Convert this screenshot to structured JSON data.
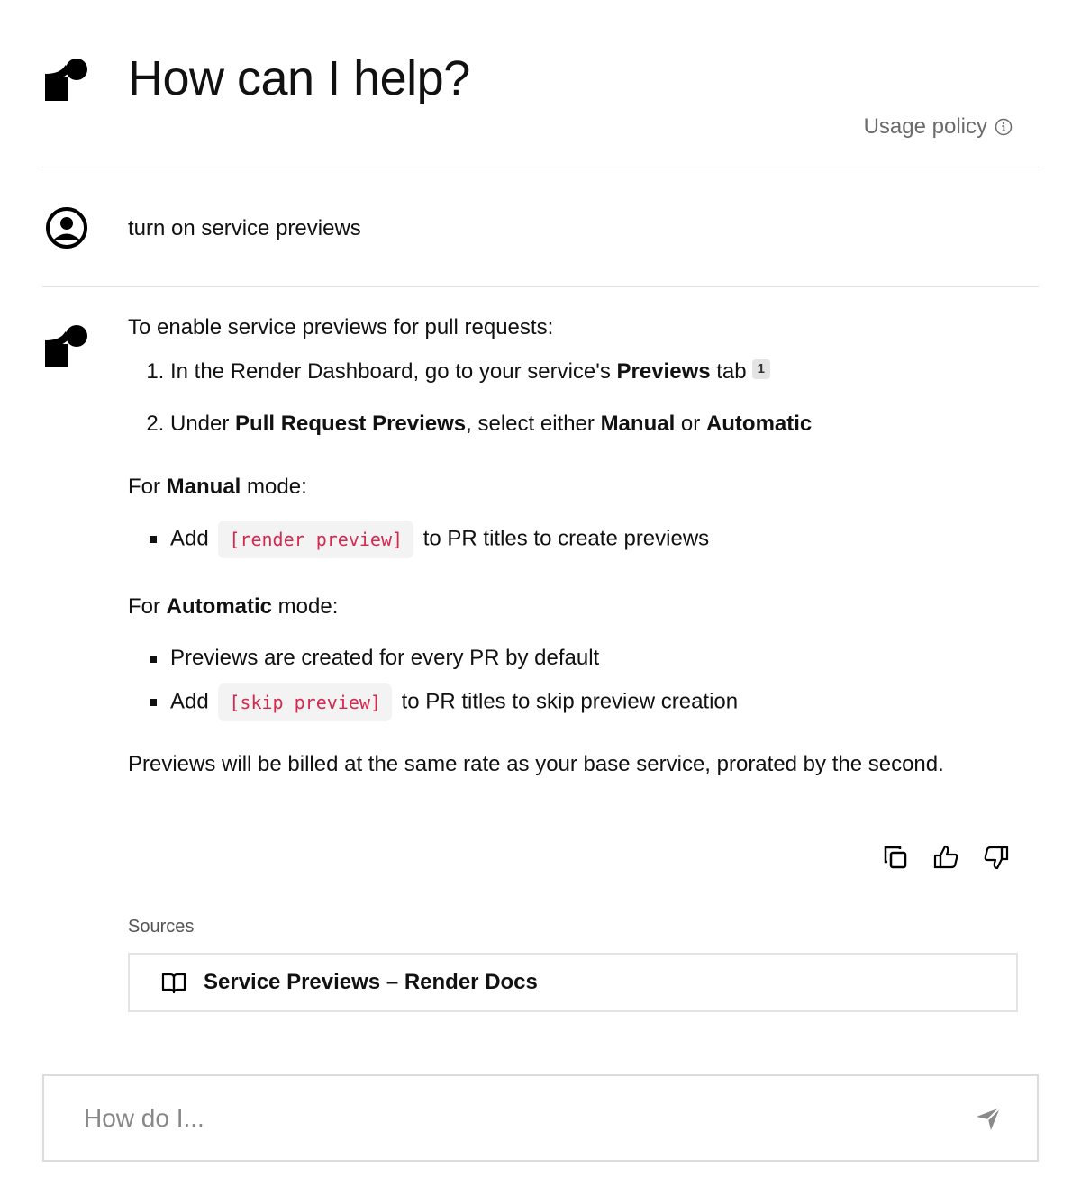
{
  "header": {
    "title": "How can I help?",
    "usage_policy": "Usage policy"
  },
  "user_message": "turn on service previews",
  "answer": {
    "intro": "To enable service previews for pull requests:",
    "steps": [
      {
        "prefix": "In the Render Dashboard, go to your service's ",
        "bold": "Previews",
        "suffix": " tab",
        "citation": "1"
      },
      {
        "prefix": "Under ",
        "bold1": "Pull Request Previews",
        "mid": ", select either ",
        "bold2": "Manual",
        "or": " or ",
        "bold3": "Automatic"
      }
    ],
    "manual": {
      "for": "For ",
      "bold": "Manual",
      "mode": " mode:",
      "items": [
        {
          "before": "Add",
          "code": "[render preview]",
          "after": "to PR titles to create previews"
        }
      ]
    },
    "automatic": {
      "for": "For ",
      "bold": "Automatic",
      "mode": " mode:",
      "items": [
        {
          "text": "Previews are created for every PR by default"
        },
        {
          "before": "Add",
          "code": "[skip preview]",
          "after": "to PR titles to skip preview creation"
        }
      ]
    },
    "billing": "Previews will be billed at the same rate as your base service, prorated by the second."
  },
  "actions": {
    "icons": [
      "copy-icon",
      "thumbs-up-icon",
      "thumbs-down-icon"
    ]
  },
  "sources": {
    "label": "Sources",
    "items": [
      {
        "title": "Service Previews – Render Docs",
        "icon": "book-icon"
      }
    ]
  },
  "composer": {
    "placeholder": "How do I...",
    "value": ""
  },
  "colors": {
    "code_text": "#d6284f",
    "code_bg": "#f3f3f3",
    "muted": "#6b6b6b",
    "border": "#e2e2e2"
  }
}
